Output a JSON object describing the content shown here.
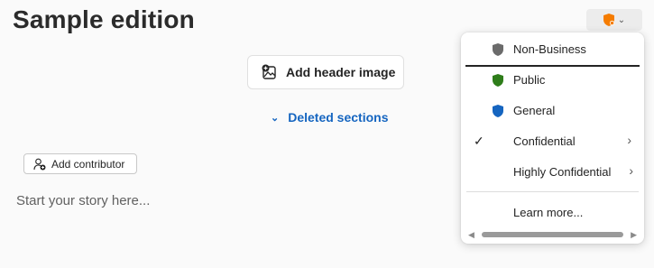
{
  "page": {
    "title": "Sample edition"
  },
  "toolbar": {
    "sensitivity_icon": "shield-orange-icon",
    "chevron": "chevron-down-icon"
  },
  "header": {
    "add_image_label": "Add header image",
    "add_image_icon": "image-add-icon"
  },
  "sections": {
    "deleted_label": "Deleted sections",
    "chevron": "chevron-down-icon"
  },
  "contributor": {
    "label": "Add contributor",
    "icon": "person-add-icon"
  },
  "story": {
    "placeholder": "Start your story here..."
  },
  "sensitivity_menu": {
    "items": [
      {
        "label": "Non-Business",
        "icon": "shield-gray-icon",
        "color": "#6b6b6b",
        "checked": false,
        "submenu": false
      },
      {
        "label": "Public",
        "icon": "shield-green-icon",
        "color": "#2e7d1a",
        "checked": false,
        "submenu": false
      },
      {
        "label": "General",
        "icon": "shield-blue-icon",
        "color": "#1565c0",
        "checked": false,
        "submenu": false
      },
      {
        "label": "Confidential",
        "icon": "",
        "color": "",
        "checked": true,
        "submenu": true
      },
      {
        "label": "Highly Confidential",
        "icon": "",
        "color": "",
        "checked": false,
        "submenu": true
      }
    ],
    "learn_more": "Learn more..."
  },
  "colors": {
    "accent": "#1565c0",
    "warning": "#f57c00"
  }
}
